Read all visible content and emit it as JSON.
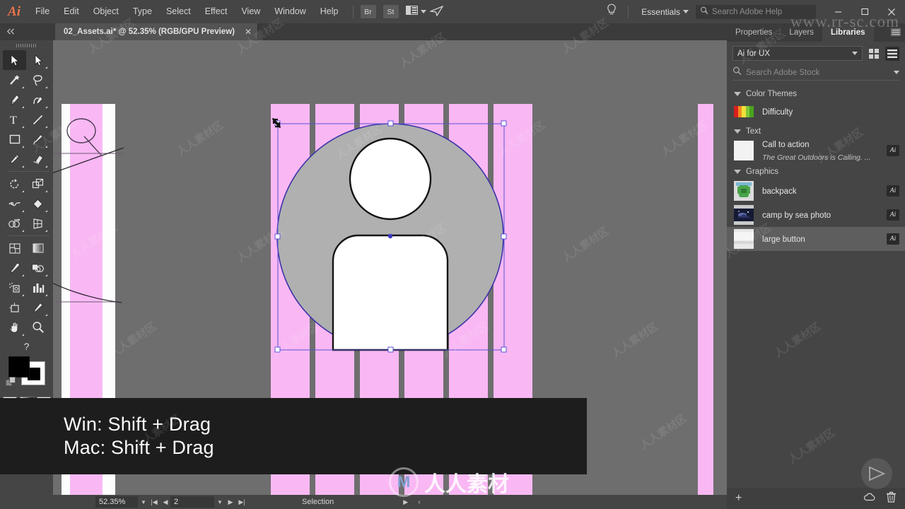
{
  "app": {
    "logo": "Ai",
    "menus": [
      "File",
      "Edit",
      "Object",
      "Type",
      "Select",
      "Effect",
      "View",
      "Window",
      "Help"
    ],
    "quick_buttons": [
      "Br",
      "St"
    ],
    "arrange_icon": "arrange-documents-icon",
    "share_icon": "share-icon",
    "bulb_icon": "lightbulb-icon",
    "workspace": "Essentials",
    "help_search_placeholder": "Search Adobe Help",
    "window_controls": [
      "minimize",
      "maximize",
      "close"
    ]
  },
  "tabbar": {
    "collapse_icon": "collapse-panel-icon",
    "document_title": "02_Assets.ai* @ 52.35% (RGB/GPU Preview)",
    "close_icon": "close-icon"
  },
  "toolbar": {
    "tools": [
      {
        "name": "selection-tool",
        "selected": true,
        "flyout": false
      },
      {
        "name": "direct-selection-tool",
        "selected": false,
        "flyout": true
      },
      {
        "name": "magic-wand-tool",
        "selected": false,
        "flyout": true
      },
      {
        "name": "lasso-tool",
        "selected": false,
        "flyout": true
      },
      {
        "name": "pen-tool",
        "selected": false,
        "flyout": true
      },
      {
        "name": "curvature-tool",
        "selected": false,
        "flyout": true
      },
      {
        "name": "type-tool",
        "selected": false,
        "flyout": true
      },
      {
        "name": "line-segment-tool",
        "selected": false,
        "flyout": true
      },
      {
        "name": "rectangle-tool",
        "selected": false,
        "flyout": true
      },
      {
        "name": "paintbrush-tool",
        "selected": false,
        "flyout": true
      },
      {
        "name": "pencil-tool",
        "selected": false,
        "flyout": true
      },
      {
        "name": "eraser-tool",
        "selected": false,
        "flyout": true
      },
      {
        "name": "rotate-tool",
        "selected": false,
        "flyout": true
      },
      {
        "name": "scale-tool",
        "selected": false,
        "flyout": true
      },
      {
        "name": "width-tool",
        "selected": false,
        "flyout": true
      },
      {
        "name": "free-transform-tool",
        "selected": false,
        "flyout": true
      },
      {
        "name": "shape-builder-tool",
        "selected": false,
        "flyout": true
      },
      {
        "name": "perspective-grid-tool",
        "selected": false,
        "flyout": true
      },
      {
        "name": "mesh-tool",
        "selected": false,
        "flyout": false
      },
      {
        "name": "gradient-tool",
        "selected": false,
        "flyout": false
      },
      {
        "name": "eyedropper-tool",
        "selected": false,
        "flyout": true
      },
      {
        "name": "blend-tool",
        "selected": false,
        "flyout": true
      },
      {
        "name": "symbol-sprayer-tool",
        "selected": false,
        "flyout": true
      },
      {
        "name": "column-graph-tool",
        "selected": false,
        "flyout": true
      },
      {
        "name": "artboard-tool",
        "selected": false,
        "flyout": false
      },
      {
        "name": "slice-tool",
        "selected": false,
        "flyout": true
      },
      {
        "name": "hand-tool",
        "selected": false,
        "flyout": true
      },
      {
        "name": "zoom-tool",
        "selected": false,
        "flyout": false
      }
    ],
    "help_label": "?",
    "fill_color": "#000000",
    "stroke_color": "#ffffff",
    "color_modes": [
      "color-swatch",
      "gradient-swatch",
      "none-swatch"
    ],
    "drawing_modes": [
      "draw-normal",
      "draw-behind",
      "draw-inside"
    ],
    "screen_mode": "change-screen-mode"
  },
  "canvas": {
    "background": "#6e6e6e",
    "artboard_color": "#f9b8f3",
    "column_color": "#f9b8f3",
    "white_column_color": "#fdfdfd",
    "selection_color": "#4c45c8",
    "avatar": {
      "circle_fill": "#b0b0b0",
      "head_fill": "#ffffff",
      "body_fill": "#ffffff",
      "stroke": "#141414"
    }
  },
  "statusbar": {
    "zoom": "52.35%",
    "page": "2",
    "nav_first": "first-page-icon",
    "nav_prev": "previous-page-icon",
    "nav_next": "next-page-icon",
    "nav_last": "last-page-icon",
    "status_text": "Selection",
    "play_icon": "play-icon",
    "left_icon": "collapse-left-icon"
  },
  "right_panel": {
    "tabs": [
      {
        "label": "Properties",
        "active": false
      },
      {
        "label": "Layers",
        "active": false
      },
      {
        "label": "Libraries",
        "active": true
      }
    ],
    "panel_menu_icon": "panel-menu-icon",
    "library_name": "Ai for UX",
    "view_grid_icon": "grid-view-icon",
    "view_list_icon": "list-view-icon",
    "search_placeholder": "Search Adobe Stock",
    "search_icon": "search-icon",
    "search_chevron": "chevron-down-icon",
    "sections": [
      {
        "title": "Color Themes",
        "items": [
          {
            "name": "Difficulty",
            "subtitle": "",
            "badge": "",
            "selected": false,
            "thumb_type": "swatches",
            "swatches": [
              "#d81f1f",
              "#ef8c1e",
              "#f2e03a",
              "#7ec53a",
              "#4aa31e"
            ]
          }
        ]
      },
      {
        "title": "Text",
        "items": [
          {
            "name": "Call to action",
            "subtitle": "The Great Outdoors is Calling. ...",
            "badge": "Ai",
            "selected": false,
            "thumb_type": "text"
          }
        ]
      },
      {
        "title": "Graphics",
        "items": [
          {
            "name": "backpack",
            "subtitle": "",
            "badge": "Ai",
            "selected": false,
            "thumb_type": "backpack"
          },
          {
            "name": "camp by sea photo",
            "subtitle": "",
            "badge": "Ai",
            "selected": false,
            "thumb_type": "photo"
          },
          {
            "name": "large button",
            "subtitle": "",
            "badge": "Ai",
            "selected": true,
            "thumb_type": "button"
          }
        ]
      }
    ],
    "footer": {
      "add_icon": "add-item-icon",
      "cc_icon": "creative-cloud-icon",
      "delete_icon": "trash-icon"
    }
  },
  "caption": {
    "line1": "Win: Shift + Drag",
    "line2": "Mac: Shift + Drag"
  },
  "watermarks": {
    "url": "www.rr-sc.com",
    "brand": "人人素材",
    "tile": "人人素材区"
  }
}
